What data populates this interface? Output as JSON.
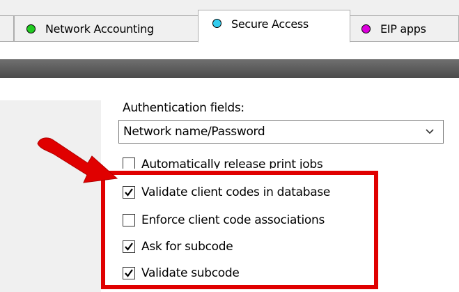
{
  "tabs": [
    {
      "label": "Network Accounting",
      "dot_color": "#22cc22",
      "active": false
    },
    {
      "label": "Secure Access",
      "dot_color": "#33ccee",
      "active": true
    },
    {
      "label": "EIP apps",
      "dot_color": "#dd00dd",
      "active": false
    }
  ],
  "auth": {
    "label": "Authentication fields:",
    "selected": "Network name/Password"
  },
  "checkboxes": [
    {
      "label": "Automatically release print jobs",
      "checked": false
    },
    {
      "label": "Validate client codes in database",
      "checked": true
    },
    {
      "label": "Enforce client code associations",
      "checked": false
    },
    {
      "label": "Ask for subcode",
      "checked": true
    },
    {
      "label": "Validate subcode",
      "checked": true
    }
  ],
  "annotation": {
    "highlight_color": "#e00000",
    "arrow_color": "#e00000"
  }
}
